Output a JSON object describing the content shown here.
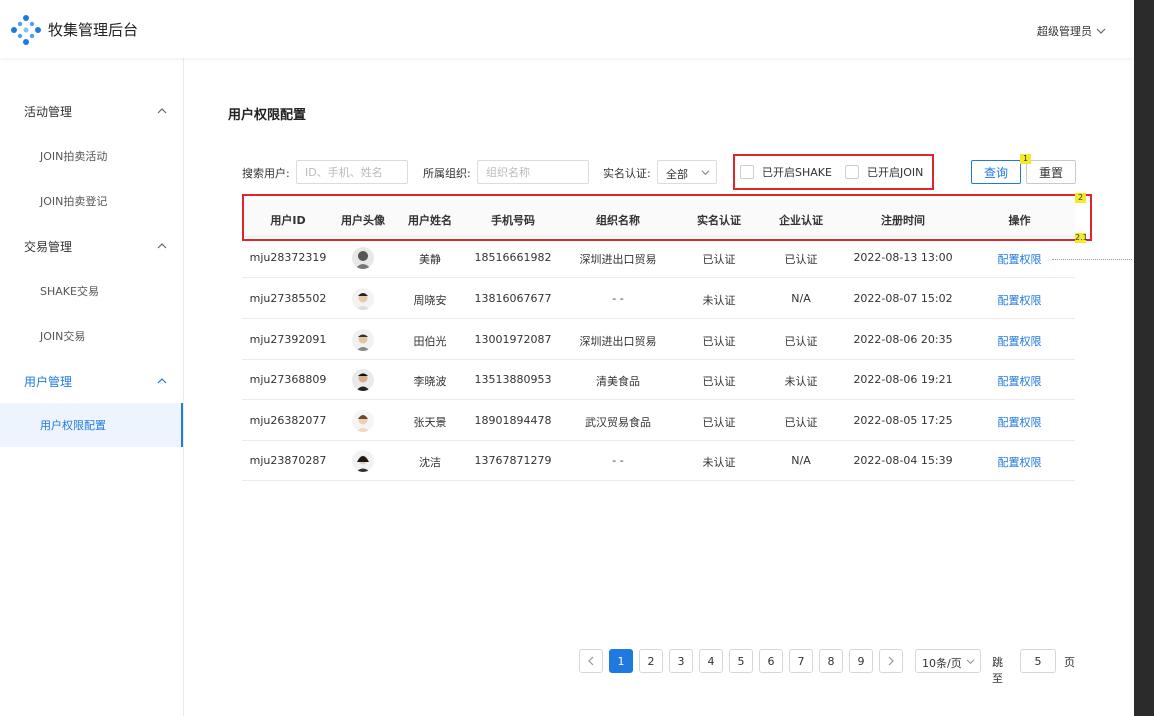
{
  "header": {
    "brand": "牧集管理后台",
    "user": "超级管理员"
  },
  "sidebar": {
    "groups": [
      {
        "label": "活动管理",
        "items": [
          "JOIN拍卖活动",
          "JOIN拍卖登记"
        ]
      },
      {
        "label": "交易管理",
        "items": [
          "SHAKE交易",
          "JOIN交易"
        ]
      },
      {
        "label": "用户管理",
        "items": [
          "用户权限配置"
        ]
      }
    ]
  },
  "page": {
    "title": "用户权限配置"
  },
  "filters": {
    "search_label": "搜索用户:",
    "search_placeholder": "ID、手机、姓名",
    "org_label": "所属组织:",
    "org_placeholder": "组织名称",
    "verify_label": "实名认证:",
    "verify_value": "全部",
    "shake_label": "已开启SHAKE",
    "join_label": "已开启JOIN",
    "query_label": "查询",
    "reset_label": "重置"
  },
  "markers": {
    "m1": "1",
    "m2": "2",
    "m3": "2.1"
  },
  "table": {
    "columns": [
      "用户ID",
      "用户头像",
      "用户姓名",
      "手机号码",
      "组织名称",
      "实名认证",
      "企业认证",
      "注册时间",
      "操作"
    ],
    "rows": [
      {
        "id": "mju28372319",
        "name": "美静",
        "phone": "18516661982",
        "org": "深圳进出口贸易",
        "verify": "已认证",
        "corp": "已认证",
        "time": "2022-08-13 13:00",
        "action": "配置权限"
      },
      {
        "id": "mju27385502",
        "name": "周晓安",
        "phone": "13816067677",
        "org": "- -",
        "verify": "未认证",
        "corp": "N/A",
        "time": "2022-08-07 15:02",
        "action": "配置权限"
      },
      {
        "id": "mju27392091",
        "name": "田伯光",
        "phone": "13001972087",
        "org": "深圳进出口贸易",
        "verify": "已认证",
        "corp": "已认证",
        "time": "2022-08-06 20:35",
        "action": "配置权限"
      },
      {
        "id": "mju27368809",
        "name": "李晓波",
        "phone": "13513880953",
        "org": "清美食品",
        "verify": "已认证",
        "corp": "未认证",
        "time": "2022-08-06 19:21",
        "action": "配置权限"
      },
      {
        "id": "mju26382077",
        "name": "张天景",
        "phone": "18901894478",
        "org": "武汉贸易食品",
        "verify": "已认证",
        "corp": "已认证",
        "time": "2022-08-05 17:25",
        "action": "配置权限"
      },
      {
        "id": "mju23870287",
        "name": "沈洁",
        "phone": "13767871279",
        "org": "- -",
        "verify": "未认证",
        "corp": "N/A",
        "time": "2022-08-04 15:39",
        "action": "配置权限"
      }
    ]
  },
  "pagination": {
    "pages": [
      "1",
      "2",
      "3",
      "4",
      "5",
      "6",
      "7",
      "8",
      "9"
    ],
    "current": "1",
    "page_size": "10条/页",
    "jump_label": "跳至",
    "jump_value": "5",
    "page_suffix": "页"
  },
  "colors": {
    "accent": "#1f7ae0",
    "annotation": "#e0252c",
    "marker": "#f6e928"
  }
}
